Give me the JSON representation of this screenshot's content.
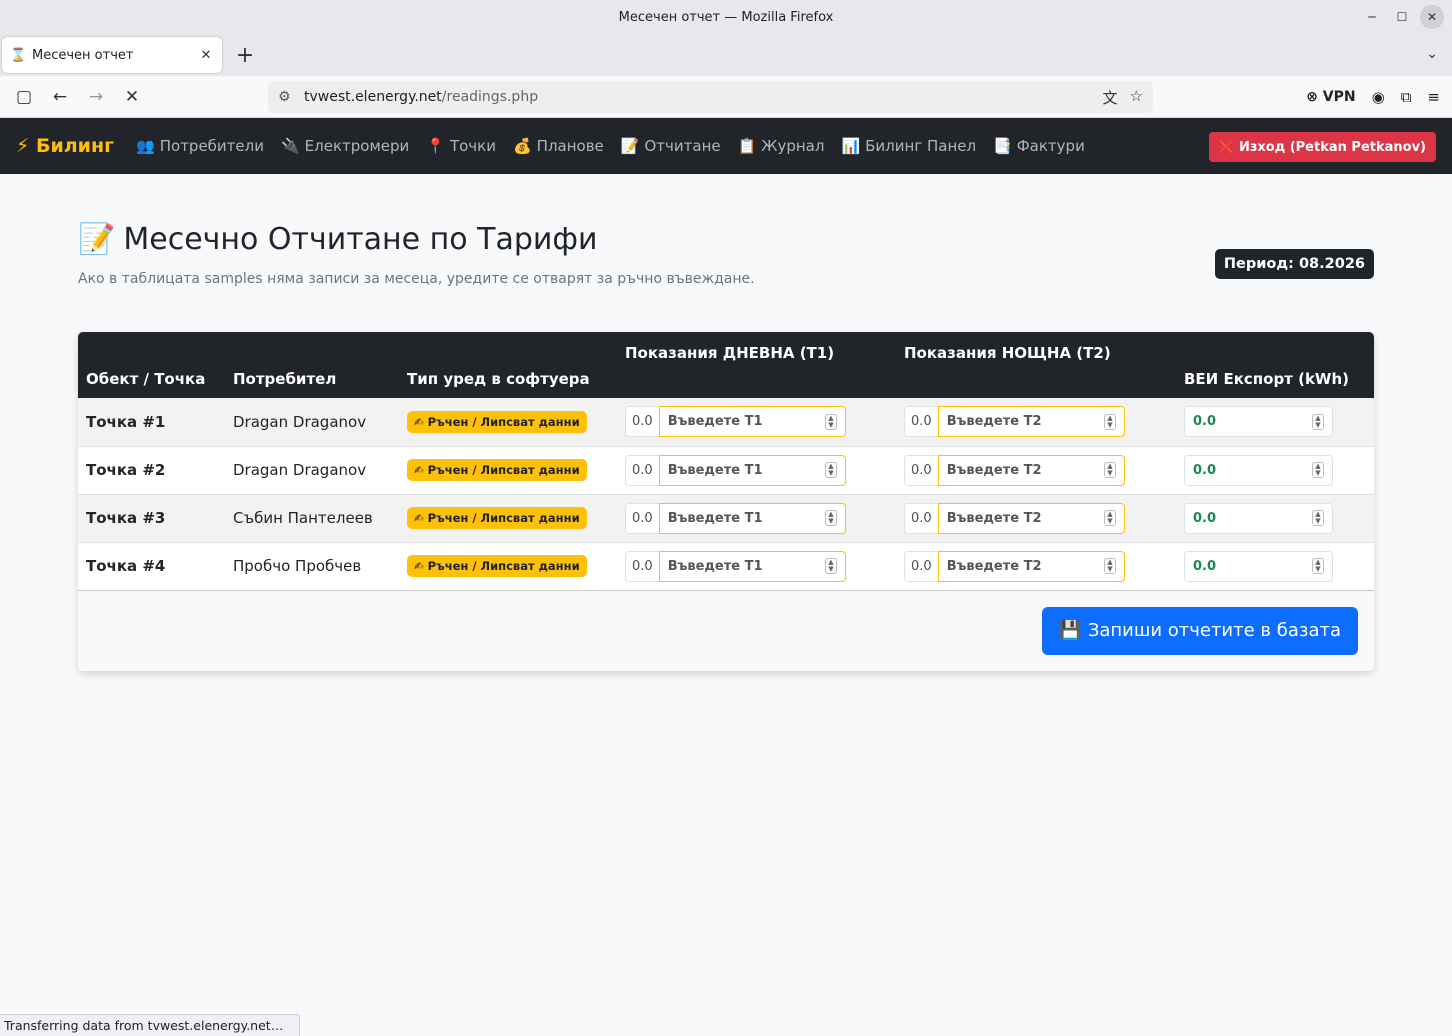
{
  "window": {
    "title": "Месечен отчет — Mozilla Firefox",
    "tab_title": "Месечен отчет",
    "url_host": "tvwest.elenergy.net",
    "url_path": "/readings.php",
    "vpn_label": "VPN"
  },
  "app": {
    "brand": "⚡ Билинг",
    "nav": [
      {
        "icon": "👥",
        "label": "Потребители"
      },
      {
        "icon": "🔌",
        "label": "Електромери"
      },
      {
        "icon": "📍",
        "label": "Точки"
      },
      {
        "icon": "💰",
        "label": "Планове"
      },
      {
        "icon": "📝",
        "label": "Отчитане"
      },
      {
        "icon": "📋",
        "label": "Журнал"
      },
      {
        "icon": "📊",
        "label": "Билинг Панел"
      },
      {
        "icon": "📑",
        "label": "Фактури"
      }
    ],
    "logout_label": "Изход (Petkan Petkanov)",
    "logout_icon": "❌"
  },
  "page": {
    "title_icon": "📝",
    "title": "Месечно Отчитане по Тарифи",
    "subtitle": "Ако в таблицата samples няма записи за месеца, уредите се отварят за ръчно въвеждане.",
    "period": "Период: 08.2026"
  },
  "table": {
    "headers": {
      "point": "Обект / Точка",
      "consumer": "Потребител",
      "type": "Тип уред в софтуера",
      "t1": "Показания ДНЕВНА (T1)",
      "t2": "Показания НОЩНА (T2)",
      "export": "ВЕИ Експорт (kWh)"
    },
    "rows": [
      {
        "point": "Точка #1",
        "consumer": "Dragan Draganov",
        "type": "Ръчен / Липсват данни",
        "t1_prev": "0.0",
        "t1_placeholder": "Въведете T1",
        "t2_prev": "0.0",
        "t2_placeholder": "Въведете T2",
        "export": "0.0"
      },
      {
        "point": "Точка #2",
        "consumer": "Dragan Draganov",
        "type": "Ръчен / Липсват данни",
        "t1_prev": "0.0",
        "t1_placeholder": "Въведете T1",
        "t2_prev": "0.0",
        "t2_placeholder": "Въведете T2",
        "export": "0.0"
      },
      {
        "point": "Точка #3",
        "consumer": "Събин Пантелеев",
        "type": "Ръчен / Липсват данни",
        "t1_prev": "0.0",
        "t1_placeholder": "Въведете T1",
        "t2_prev": "0.0",
        "t2_placeholder": "Въведете T2",
        "export": "0.0"
      },
      {
        "point": "Точка #4",
        "consumer": "Пробчо Пробчев",
        "type": "Ръчен / Липсват данни",
        "t1_prev": "0.0",
        "t1_placeholder": "Въведете T1",
        "t2_prev": "0.0",
        "t2_placeholder": "Въведете T2",
        "export": "0.0"
      }
    ]
  },
  "save_label": "Запиши отчетите в базата",
  "save_icon": "💾",
  "status_text": "Transferring data from tvwest.elenergy.net…",
  "colors": {
    "navbar_bg": "#212529",
    "brand": "#ffc107",
    "danger": "#dc3545",
    "primary": "#0d6efd",
    "warning": "#ffc107",
    "success": "#198754"
  }
}
